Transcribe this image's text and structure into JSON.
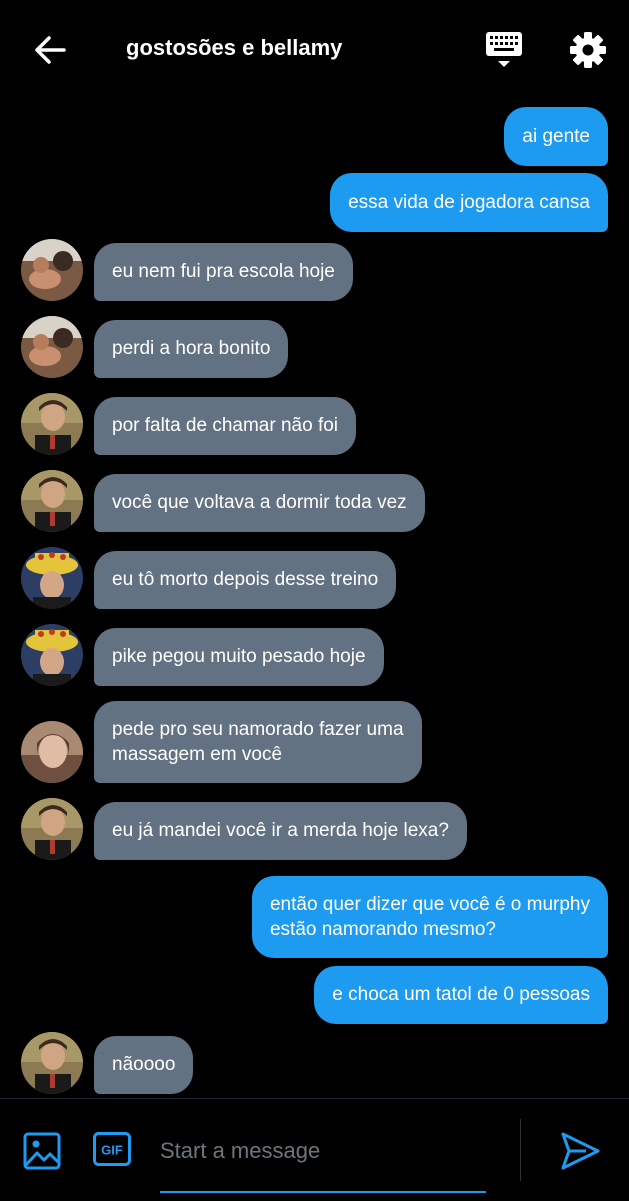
{
  "header": {
    "title": "gostosões e bellamy",
    "icons": [
      "arrow-left-icon",
      "keyboard-icon",
      "gear-icon"
    ]
  },
  "colors": {
    "background": "#000000",
    "outgoing_bubble": "#1d9bf0",
    "incoming_bubble": "#637282",
    "accent": "#1d9bf0"
  },
  "messages": [
    {
      "direction": "out",
      "text": "ai gente"
    },
    {
      "direction": "out",
      "text": "essa vida de jogadora cansa"
    },
    {
      "direction": "in",
      "text": "eu nem fui pra escola hoje"
    },
    {
      "direction": "in",
      "text": "perdi a hora bonito"
    },
    {
      "direction": "in",
      "text": "por falta de chamar não foi"
    },
    {
      "direction": "in",
      "text": "você que voltava a dormir toda vez"
    },
    {
      "direction": "in",
      "text": "eu tô morto depois desse treino"
    },
    {
      "direction": "in",
      "text": "pike pegou muito pesado hoje"
    },
    {
      "direction": "in",
      "lines": [
        "pede pro seu namorado fazer uma",
        "massagem em você"
      ]
    },
    {
      "direction": "in",
      "text": "eu já mandei você ir a merda hoje lexa?"
    },
    {
      "direction": "out",
      "lines": [
        "então quer dizer que você é o murphy",
        "estão namorando mesmo?"
      ]
    },
    {
      "direction": "out",
      "text": "e choca um tatol de 0 pessoas"
    },
    {
      "direction": "in",
      "text": "nãoooo"
    }
  ],
  "composer": {
    "placeholder": "Start a message",
    "gif_label": "GIF",
    "icons": [
      "image-icon",
      "gif-icon",
      "send-icon"
    ]
  }
}
